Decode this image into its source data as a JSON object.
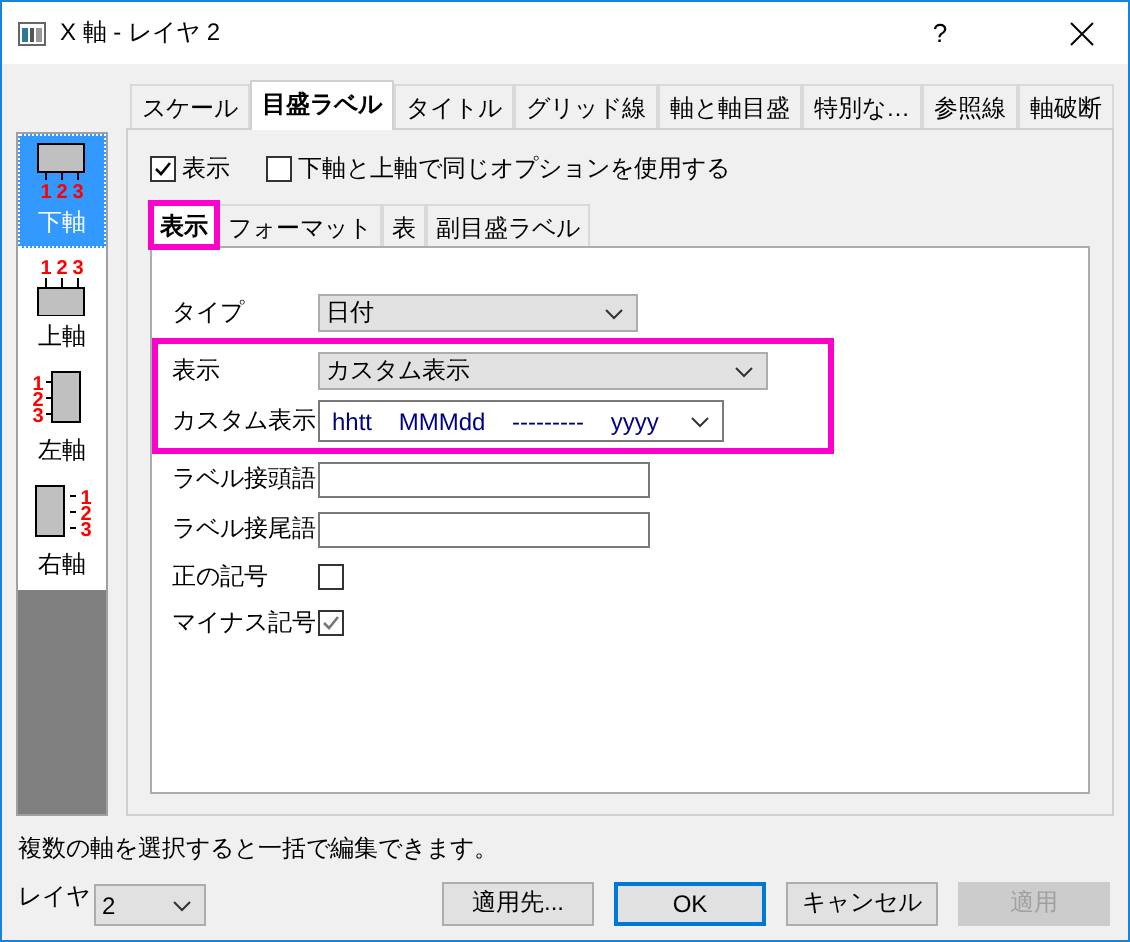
{
  "window": {
    "title": "X 軸 - レイヤ 2",
    "help": "?"
  },
  "sidebar": {
    "items": [
      {
        "kind": "bottom",
        "tick_labels": "123",
        "label": "下軸",
        "selected": true
      },
      {
        "kind": "top",
        "tick_labels": "123",
        "label": "上軸",
        "selected": false
      },
      {
        "kind": "left",
        "tick_labels": "123",
        "label": "左軸",
        "selected": false
      },
      {
        "kind": "right",
        "tick_labels": "123",
        "label": "右軸",
        "selected": false
      }
    ]
  },
  "tabs": [
    {
      "label": "スケール",
      "selected": false
    },
    {
      "label": "目盛ラベル",
      "selected": true
    },
    {
      "label": "タイトル",
      "selected": false
    },
    {
      "label": "グリッド線",
      "selected": false
    },
    {
      "label": "軸と軸目盛",
      "selected": false
    },
    {
      "label": "特別な…",
      "selected": false
    },
    {
      "label": "参照線",
      "selected": false
    },
    {
      "label": "軸破断",
      "selected": false
    }
  ],
  "options": [
    {
      "label": "表示",
      "checked": true
    },
    {
      "label": "下軸と上軸で同じオプションを使用する",
      "checked": false
    }
  ],
  "inner_tabs": [
    {
      "label": "表示",
      "selected": true,
      "highlighted": true
    },
    {
      "label": "フォーマット",
      "selected": false,
      "highlighted": false
    },
    {
      "label": "表",
      "selected": false,
      "highlighted": false
    },
    {
      "label": "副目盛ラベル",
      "selected": false,
      "highlighted": false
    }
  ],
  "fields": [
    {
      "kind": "dropdown",
      "label": "タイプ",
      "value": "日付",
      "highlighted": false
    },
    {
      "kind": "dropdown",
      "label": "表示",
      "value": "カスタム表示",
      "highlighted": true
    },
    {
      "kind": "combo",
      "label": "カスタム表示",
      "value": "hhtt    MMMdd    ---------    yyyy",
      "highlighted": true
    },
    {
      "kind": "text",
      "label": "ラベル接頭語",
      "highlighted": false
    },
    {
      "kind": "text",
      "label": "ラベル接尾語",
      "highlighted": false
    },
    {
      "kind": "checkbox",
      "label": "正の記号",
      "checked": false,
      "highlighted": false
    },
    {
      "kind": "checkbox",
      "label": "マイナス記号",
      "checked": true,
      "highlighted": false
    }
  ],
  "hint": "複数の軸を選択すると一括で編集できます。",
  "layer": {
    "label": "レイヤ",
    "value": "2"
  },
  "buttons": [
    {
      "label": "適用先...",
      "default": false,
      "disabled": false
    },
    {
      "label": "OK",
      "default": true,
      "disabled": false
    },
    {
      "label": "キャンセル",
      "default": false,
      "disabled": false
    },
    {
      "label": "適用",
      "default": false,
      "disabled": true
    }
  ]
}
